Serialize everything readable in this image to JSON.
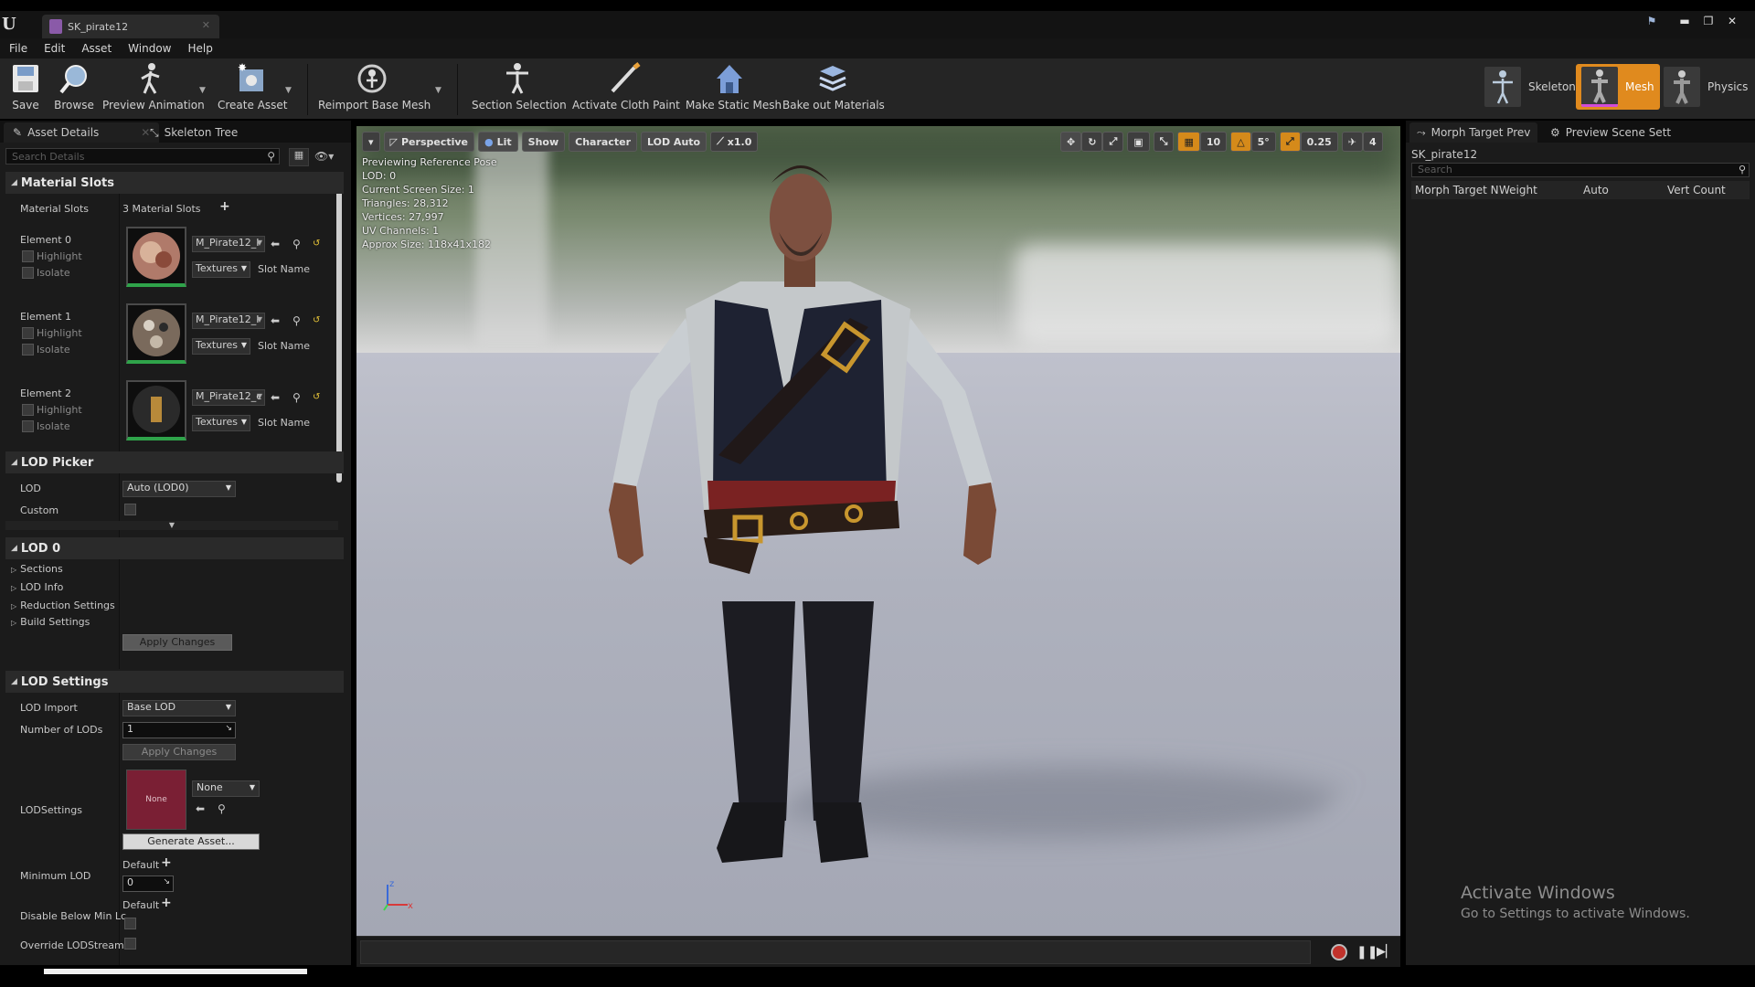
{
  "titlebar": {
    "tab_title": "SK_pirate12"
  },
  "menu": [
    "File",
    "Edit",
    "Asset",
    "Window",
    "Help"
  ],
  "toolbar": {
    "save": "Save",
    "browse": "Browse",
    "preview_animation": "Preview Animation",
    "create_asset": "Create Asset",
    "reimport_base_mesh": "Reimport Base Mesh",
    "section_selection": "Section Selection",
    "activate_cloth_paint": "Activate Cloth Paint",
    "make_static_mesh": "Make Static Mesh",
    "bake_out_materials": "Bake out Materials"
  },
  "modes": {
    "skeleton": "Skeleton",
    "mesh": "Mesh",
    "physics": "Physics"
  },
  "left_panel": {
    "tab_asset_details": "Asset Details",
    "tab_skeleton_tree": "Skeleton Tree",
    "search_placeholder": "Search Details",
    "material_slots": {
      "header": "Material Slots",
      "label": "Material Slots",
      "count": "3 Material Slots",
      "highlight": "Highlight",
      "isolate": "Isolate",
      "textures": "Textures",
      "slot_name": "Slot Name",
      "elements": [
        {
          "label": "Element 0",
          "material": "M_Pirate12_I"
        },
        {
          "label": "Element 1",
          "material": "M_Pirate12_I"
        },
        {
          "label": "Element 2",
          "material": "M_Pirate12_c"
        }
      ]
    },
    "lod_picker": {
      "header": "LOD Picker",
      "lod_label": "LOD",
      "lod_value": "Auto (LOD0)",
      "custom_label": "Custom"
    },
    "lod0": {
      "header": "LOD 0",
      "items": [
        "Sections",
        "LOD Info",
        "Reduction Settings",
        "Build Settings"
      ],
      "apply_changes": "Apply Changes"
    },
    "lod_settings": {
      "header": "LOD Settings",
      "lod_import_label": "LOD Import",
      "lod_import_value": "Base LOD",
      "num_lods_label": "Number of LODs",
      "num_lods_value": "1",
      "apply_changes": "Apply Changes",
      "lodsettings_label": "LODSettings",
      "lodsettings_thumb": "None",
      "lodsettings_value": "None",
      "generate_asset": "Generate Asset...",
      "min_lod_label": "Minimum LOD",
      "min_lod_default": "Default",
      "min_lod_value": "0",
      "disable_below_label": "Disable Below Min Lc",
      "disable_below_default": "Default",
      "override_label": "Override LODStreami"
    }
  },
  "viewport": {
    "perspective": "Perspective",
    "lit": "Lit",
    "show": "Show",
    "character": "Character",
    "lod_auto": "LOD Auto",
    "speed": "x1.0",
    "grid_snap": "10",
    "rot_snap": "5°",
    "scale_snap": "0.25",
    "cam_speed": "4",
    "stats": [
      "Previewing Reference Pose",
      "LOD: 0",
      "Current Screen Size: 1",
      "Triangles: 28,312",
      "Vertices: 27,997",
      "UV Channels: 1",
      "Approx Size: 118x41x182"
    ]
  },
  "right_panel": {
    "tab_morph": "Morph Target Prev",
    "tab_preview_scene": "Preview Scene Sett",
    "asset_name": "SK_pirate12",
    "search_placeholder": "Search",
    "col_name": "Morph Target N",
    "col_weight": "Weight",
    "col_auto": "Auto",
    "col_vert": "Vert Count"
  },
  "watermark": {
    "line1": "Activate Windows",
    "line2": "Go to Settings to activate Windows."
  }
}
